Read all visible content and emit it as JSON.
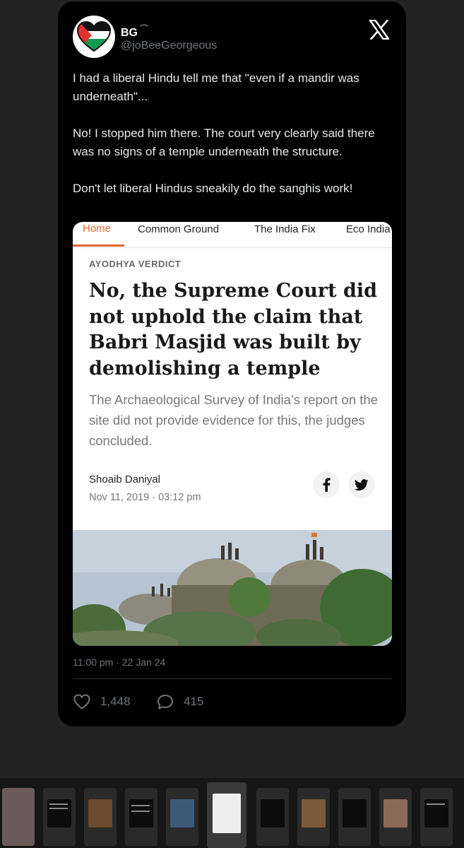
{
  "tweet": {
    "display_name": "BG",
    "name_decoration": "⌒",
    "handle": "@joBeeGeorgeous",
    "paragraphs": [
      "I had a liberal Hindu tell me that \"even if a mandir was underneath\"...",
      "No! I stopped him there. The court very clearly said there was no signs of a temple underneath the structure.",
      "Don't let liberal Hindus sneakily do the sanghis work!"
    ],
    "timestamp": "11:00 pm · 22 Jan 24",
    "likes": "1,448",
    "replies": "415"
  },
  "embed": {
    "tabs": [
      "Home",
      "Common Ground",
      "The India Fix",
      "Eco India"
    ],
    "active_tab": "Home",
    "kicker": "AYODHYA VERDICT",
    "headline": "No, the Supreme Court did not uphold the claim that Babri Masjid was built by demolishing a temple",
    "subhead": "The Archaeological Survey of India’s report on the site did not provide evidence for this, the judges concluded.",
    "author": "Shoaib Daniyal",
    "date": "Nov 11, 2019 · 03:12 pm"
  },
  "colors": {
    "accent": "#e5642e",
    "card_bg": "#000000",
    "page_bg": "#232323"
  },
  "icons": [
    "x-logo-icon",
    "facebook-icon",
    "twitter-bird-icon",
    "heart-icon",
    "reply-bubble-icon"
  ]
}
